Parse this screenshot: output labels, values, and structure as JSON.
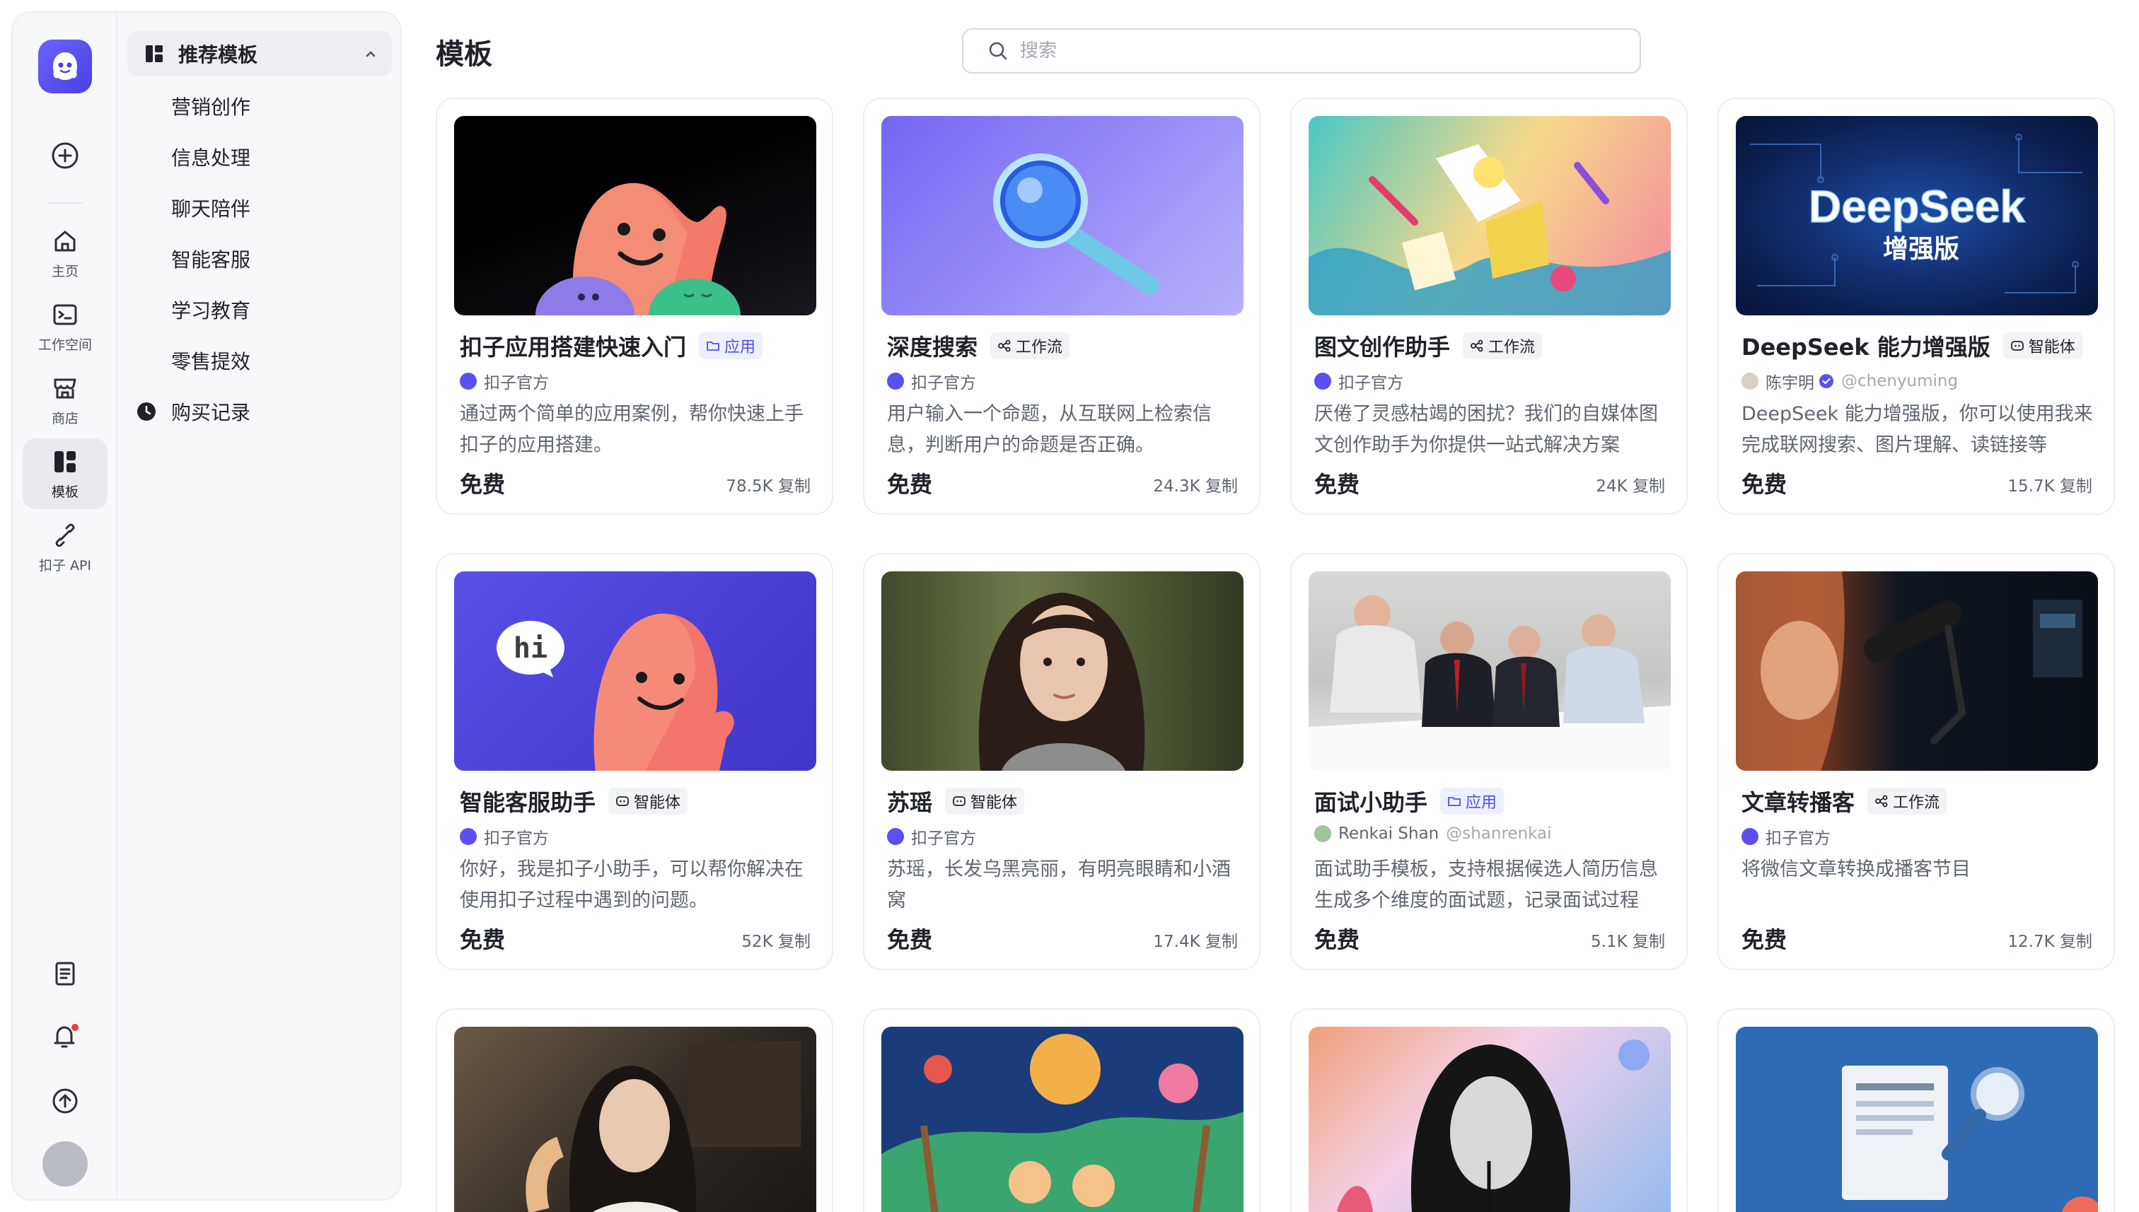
{
  "app": {
    "accent": "#5a50f0"
  },
  "rail": {
    "items": [
      {
        "label": "主页",
        "icon": "home-icon"
      },
      {
        "label": "工作空间",
        "icon": "workspace-icon"
      },
      {
        "label": "商店",
        "icon": "store-icon"
      },
      {
        "label": "模板",
        "icon": "template-icon",
        "active": true
      },
      {
        "label": "扣子 API",
        "icon": "api-icon"
      }
    ]
  },
  "categories": {
    "header": "推荐模板",
    "items": [
      "营销创作",
      "信息处理",
      "聊天陪伴",
      "智能客服",
      "学习教育",
      "零售提效"
    ],
    "purchase_history": "购买记录"
  },
  "main": {
    "title": "模板",
    "search_placeholder": "搜索"
  },
  "cards": [
    {
      "name": "扣子应用搭建快速入门",
      "tag": "应用",
      "tag_type": "app",
      "author": "扣子官方",
      "handle": "",
      "desc": "通过两个简单的应用案例，帮你快速上手扣子的应用搭建。",
      "price": "免费",
      "copies": "78.5K 复制"
    },
    {
      "name": "深度搜索",
      "tag": "工作流",
      "tag_type": "flow",
      "author": "扣子官方",
      "handle": "",
      "desc": "用户输入一个命题，从互联网上检索信息，判断用户的命题是否正确。",
      "price": "免费",
      "copies": "24.3K 复制"
    },
    {
      "name": "图文创作助手",
      "tag": "工作流",
      "tag_type": "flow",
      "author": "扣子官方",
      "handle": "",
      "desc": "厌倦了灵感枯竭的困扰？我们的自媒体图文创作助手为你提供一站式解决方案",
      "price": "免费",
      "copies": "24K 复制"
    },
    {
      "name": "DeepSeek 能力增强版",
      "tag": "智能体",
      "tag_type": "agent",
      "author": "陈宇明",
      "handle": "@chenyuming",
      "desc": "DeepSeek 能力增强版，你可以使用我来完成联网搜索、图片理解、读链接等",
      "price": "免费",
      "copies": "15.7K 复制"
    },
    {
      "name": "智能客服助手",
      "tag": "智能体",
      "tag_type": "agent",
      "author": "扣子官方",
      "handle": "",
      "desc": "你好，我是扣子小助手，可以帮你解决在使用扣子过程中遇到的问题。",
      "price": "免费",
      "copies": "52K 复制"
    },
    {
      "name": "苏瑶",
      "tag": "智能体",
      "tag_type": "agent",
      "author": "扣子官方",
      "handle": "",
      "desc": "苏瑶，长发乌黑亮丽，有明亮眼睛和小酒窝",
      "price": "免费",
      "copies": "17.4K 复制"
    },
    {
      "name": "面试小助手",
      "tag": "应用",
      "tag_type": "app",
      "author": "Renkai Shan",
      "handle": "@shanrenkai",
      "desc": "面试助手模板，支持根据候选人简历信息生成多个维度的面试题，记录面试过程",
      "price": "免费",
      "copies": "5.1K 复制"
    },
    {
      "name": "文章转播客",
      "tag": "工作流",
      "tag_type": "flow",
      "author": "扣子官方",
      "handle": "",
      "desc": "将微信文章转换成播客节目",
      "price": "免费",
      "copies": "12.7K 复制"
    }
  ],
  "thumbs": {
    "deepseek_title": "DeepSeek",
    "deepseek_subtitle": "增强版",
    "hi_bubble": "hi"
  }
}
